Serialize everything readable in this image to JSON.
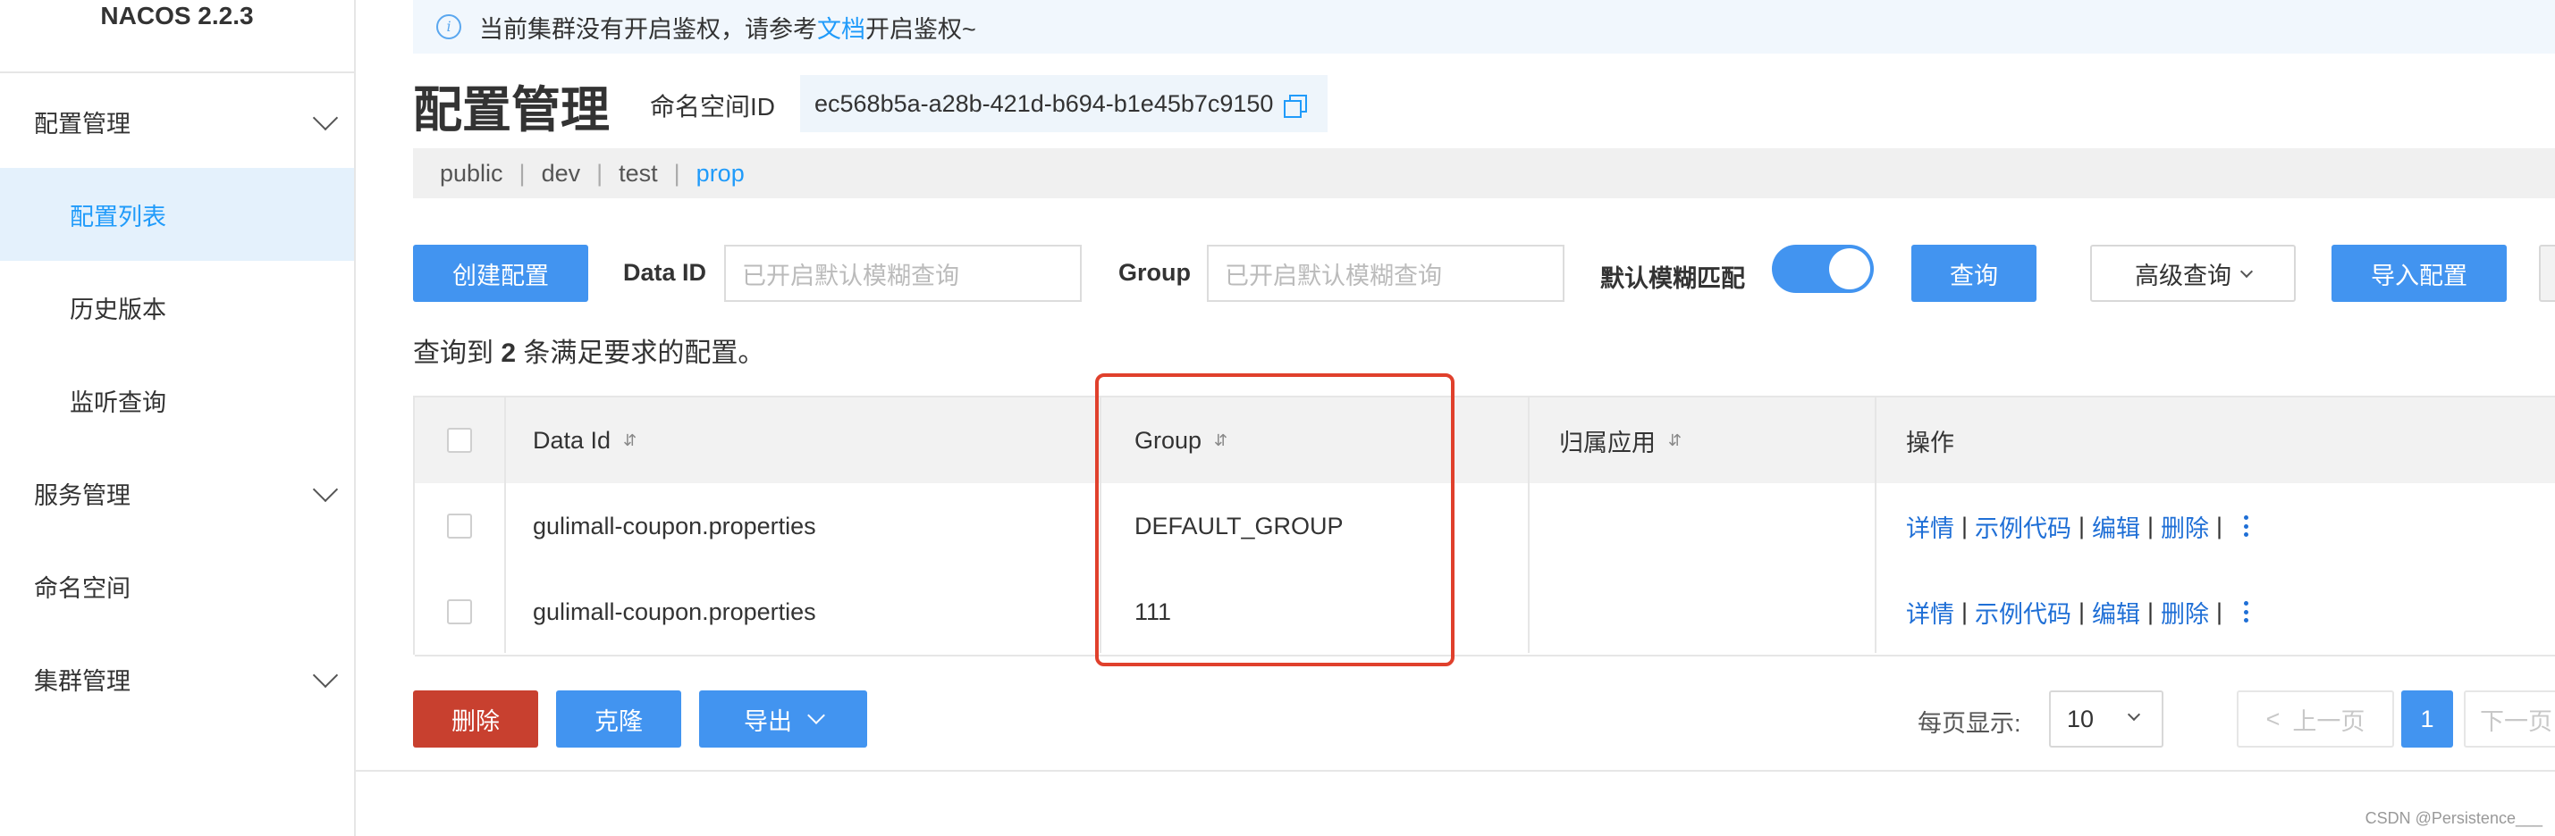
{
  "sidebar": {
    "brand": "NACOS 2.2.3",
    "items": [
      {
        "label": "配置管理"
      },
      {
        "label": "配置列表"
      },
      {
        "label": "历史版本"
      },
      {
        "label": "监听查询"
      },
      {
        "label": "服务管理"
      },
      {
        "label": "命名空间"
      },
      {
        "label": "集群管理"
      }
    ]
  },
  "notice": {
    "text_before": "当前集群没有开启鉴权，请参考",
    "link": "文档",
    "text_after": "开启鉴权~"
  },
  "header": {
    "title": "配置管理",
    "namespace_label": "命名空间ID",
    "namespace_id": "ec568b5a-a28b-421d-b694-b1e45b7c9150"
  },
  "namespaces": [
    "public",
    "dev",
    "test",
    "prop"
  ],
  "toolbar": {
    "create": "创建配置",
    "data_id_label": "Data ID",
    "data_id_placeholder": "已开启默认模糊查询",
    "group_label": "Group",
    "group_placeholder": "已开启默认模糊查询",
    "fuzzy_label": "默认模糊匹配",
    "query": "查询",
    "advanced": "高级查询",
    "import": "导入配置"
  },
  "result": {
    "prefix": "查询到",
    "count": "2",
    "suffix": "条满足要求的配置。"
  },
  "table": {
    "columns": [
      "Data Id",
      "Group",
      "归属应用",
      "操作"
    ],
    "sort_icon": "⇵",
    "rows": [
      {
        "data_id": "gulimall-coupon.properties",
        "group": "DEFAULT_GROUP",
        "app": ""
      },
      {
        "data_id": "gulimall-coupon.properties",
        "group": "111",
        "app": ""
      }
    ],
    "ops": [
      "详情",
      "示例代码",
      "编辑",
      "删除"
    ],
    "op_sep": "|"
  },
  "footer": {
    "delete": "删除",
    "clone": "克隆",
    "export": "导出",
    "page_size_label": "每页显示:",
    "page_size": "10",
    "prev": "上一页",
    "current_page": "1",
    "next": "下一页"
  },
  "watermark": "CSDN @Persistence___",
  "colors": {
    "primary": "#4294f0",
    "danger": "#c8402f",
    "link": "#1f6fd6",
    "highlight": "#e0402c"
  }
}
